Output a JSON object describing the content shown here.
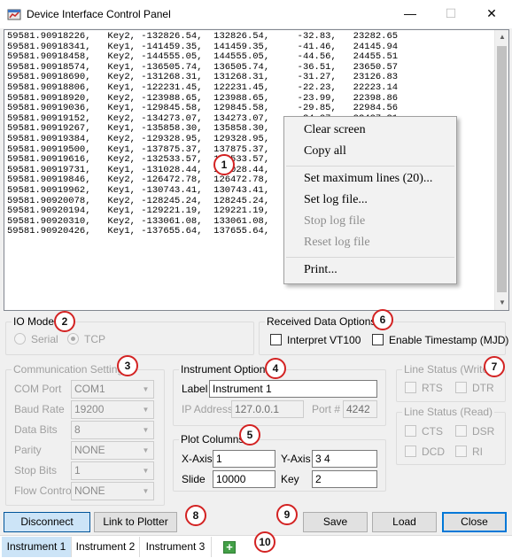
{
  "window": {
    "title": "Device Interface Control Panel",
    "minimize_icon": "minimize-icon",
    "maximize_icon": "maximize-icon",
    "close_icon": "close-icon"
  },
  "log": {
    "lines": [
      "59581.90918226,   Key2, -132826.54,  132826.54,     -32.83,   23282.65",
      "59581.90918341,   Key1, -141459.35,  141459.35,     -41.46,   24145.94",
      "59581.90918458,   Key2, -144555.05,  144555.05,     -44.56,   24455.51",
      "59581.90918574,   Key1, -136505.74,  136505.74,     -36.51,   23650.57",
      "59581.90918690,   Key2, -131268.31,  131268.31,     -31.27,   23126.83",
      "59581.90918806,   Key1, -122231.45,  122231.45,     -22.23,   22223.14",
      "59581.90918920,   Key2, -123988.65,  123988.65,     -23.99,   22398.86",
      "59581.90919036,   Key1, -129845.58,  129845.58,     -29.85,   22984.56",
      "59581.90919152,   Key2, -134273.07,  134273.07,     -34.27,   23427.31",
      "59581.90919267,   Key1, -135858.30,  135858.30,     -35.86,   23585.83",
      "59581.90919384,   Key2, -129328.95,  129328.95,     -29.33,   22932.90",
      "59581.90919500,   Key1, -137875.37,  137875.37,     -37.88,   23787.54",
      "59581.90919616,   Key2, -132533.57,  132533.57,     -32.53,   23253.36",
      "59581.90919731,   Key1, -131028.44,  131028.44,     -31.03,   23102.84",
      "59581.90919846,   Key2, -126472.78,  126472.78,     -26.47,   22647.28",
      "59581.90919962,   Key1, -130743.41,  130743.41,     -30.74,   23074.34",
      "59581.90920078,   Key2, -128245.24,  128245.24,     -28.25,   22824.52",
      "59581.90920194,   Key1, -129221.19,  129221.19,     -29.22,   22922.12",
      "59581.90920310,   Key2, -133061.08,  133061.08,     -33.06,   23306.11",
      "59581.90920426,   Key1, -137655.64,  137655.64,     -37.66,   23765.56"
    ]
  },
  "context_menu": {
    "clear_screen": "Clear screen",
    "copy_all": "Copy all",
    "set_max_lines": "Set maximum lines (20)...",
    "set_log_file": "Set log file...",
    "stop_log_file": "Stop log file",
    "reset_log_file": "Reset log file",
    "print": "Print..."
  },
  "io_mode": {
    "title": "IO Mode",
    "serial": "Serial",
    "tcp": "TCP",
    "selected": "TCP"
  },
  "received_data": {
    "title": "Received Data Options",
    "interpret_vt100": "Interpret VT100",
    "enable_timestamp": "Enable Timestamp (MJD)"
  },
  "comm_settings": {
    "title": "Communication Settings",
    "com_port_label": "COM Port",
    "com_port_value": "COM1",
    "baud_rate_label": "Baud Rate",
    "baud_rate_value": "19200",
    "data_bits_label": "Data Bits",
    "data_bits_value": "8",
    "parity_label": "Parity",
    "parity_value": "NONE",
    "stop_bits_label": "Stop Bits",
    "stop_bits_value": "1",
    "flow_control_label": "Flow Control",
    "flow_control_value": "NONE"
  },
  "instrument_options": {
    "title": "Instrument Options",
    "label_label": "Label",
    "label_value": "Instrument 1",
    "ip_label": "IP Address",
    "ip_value": "127.0.0.1",
    "port_label": "Port #",
    "port_value": "4242"
  },
  "plot_columns": {
    "title": "Plot Columns",
    "x_axis_label": "X-Axis",
    "x_axis_value": "1",
    "y_axis_label": "Y-Axis",
    "y_axis_value": "3 4",
    "slide_label": "Slide",
    "slide_value": "10000",
    "key_label": "Key",
    "key_value": "2"
  },
  "line_status_write": {
    "title": "Line Status (Write)",
    "rts": "RTS",
    "dtr": "DTR"
  },
  "line_status_read": {
    "title": "Line Status (Read)",
    "cts": "CTS",
    "dsr": "DSR",
    "dcd": "DCD",
    "ri": "RI"
  },
  "buttons": {
    "disconnect": "Disconnect",
    "link_to_plotter": "Link to Plotter",
    "save": "Save",
    "load": "Load",
    "close": "Close"
  },
  "tabs": [
    "Instrument 1",
    "Instrument 2",
    "Instrument 3"
  ],
  "add_tab_icon": "plus-icon",
  "annotations": [
    "1",
    "2",
    "3",
    "4",
    "5",
    "6",
    "7",
    "8",
    "9",
    "10"
  ],
  "colors": {
    "annotation_ring": "#d32222",
    "selection_blue": "#cce4f7",
    "focus_blue": "#0078d7",
    "add_tab_green": "#43a047"
  }
}
